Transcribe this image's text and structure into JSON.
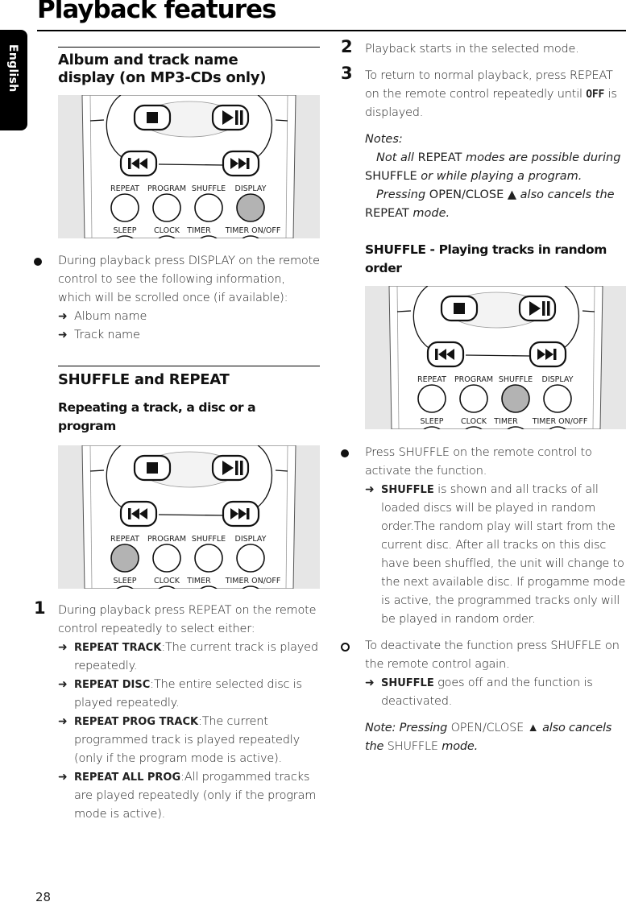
{
  "header": {
    "title": "Playback features",
    "language_tab": "English"
  },
  "remote": {
    "row1_labels": [
      "REPEAT",
      "PROGRAM",
      "SHUFFLE",
      "DISPLAY"
    ],
    "row2_labels": [
      "SLEEP",
      "CLOCK",
      "TIMER",
      "TIMER ON/OFF"
    ],
    "transport_buttons": [
      "stop",
      "play-pause",
      "previous",
      "next"
    ],
    "highlight_color": "#b3b3b3"
  },
  "left": {
    "album_section": {
      "heading": "Album and track name display (on MP3-CDs only)",
      "highlighted_button": "DISPLAY",
      "bullet": "During playback press DISPLAY on the remote control to see the following information, which will be scrolled once (if available):",
      "results": [
        "Album name",
        "Track name"
      ]
    },
    "shuffle_repeat_section": {
      "heading": "SHUFFLE and REPEAT",
      "subheading": "Repeating a track, a disc or a program",
      "highlighted_button": "REPEAT",
      "step1": {
        "number": "1",
        "text": "During playback press REPEAT on the remote control repeatedly to select either:",
        "options": [
          {
            "keyword": "REPEAT TRACK",
            "text": ":The current track is played repeatedly."
          },
          {
            "keyword": "REPEAT DISC",
            "text": ":The entire selected disc is played repeatedly."
          },
          {
            "keyword": "REPEAT PROG TRACK",
            "text": ":The current programmed track is played repeatedly (only if the program mode is active)."
          },
          {
            "keyword": "REPEAT ALL PROG",
            "text": ":All progammed tracks are played repeatedly (only if the program mode is active)."
          }
        ]
      }
    }
  },
  "right": {
    "step2": {
      "number": "2",
      "text": "Playback starts in the selected mode."
    },
    "step3": {
      "number": "3",
      "text_before": "To return to normal playback, press REPEAT on the remote control repeatedly until ",
      "display_word": "OFF",
      "text_after": " is displayed."
    },
    "notes": {
      "label": "Notes:",
      "note1": {
        "a": "Not all",
        "b": " REPEAT ",
        "c": "modes are possible during",
        "d": " SHUFFLE ",
        "e": "or while playing a program."
      },
      "note2": {
        "a": "Pressing",
        "b": " OPEN/CLOSE ▲ ",
        "c": "also cancels the",
        "d": " REPEAT ",
        "e": "mode."
      }
    },
    "shuffle_section": {
      "heading": "SHUFFLE - Playing tracks in random order",
      "highlighted_button": "SHUFFLE",
      "bullet1": "Press SHUFFLE on the remote control to activate the function.",
      "result1": {
        "keyword": "SHUFFLE",
        "text": " is shown and all tracks of all loaded discs will be played in random order.The random play will start from the current disc. After all tracks on this disc have been shuffled, the unit will change to the next available disc. If progamme mode is active, the programmed tracks only will be played in random order."
      },
      "bullet2": "To deactivate the function press SHUFFLE on the remote control again.",
      "result2": {
        "keyword": "SHUFFLE",
        "text": " goes off and the function is deactivated."
      },
      "note": {
        "a": "Note: Pressing",
        "b": " OPEN/CLOSE ▲ ",
        "c": "also cancels the",
        "d": " SHUFFLE ",
        "e": "mode."
      }
    }
  },
  "footer": {
    "page_number": "28"
  }
}
